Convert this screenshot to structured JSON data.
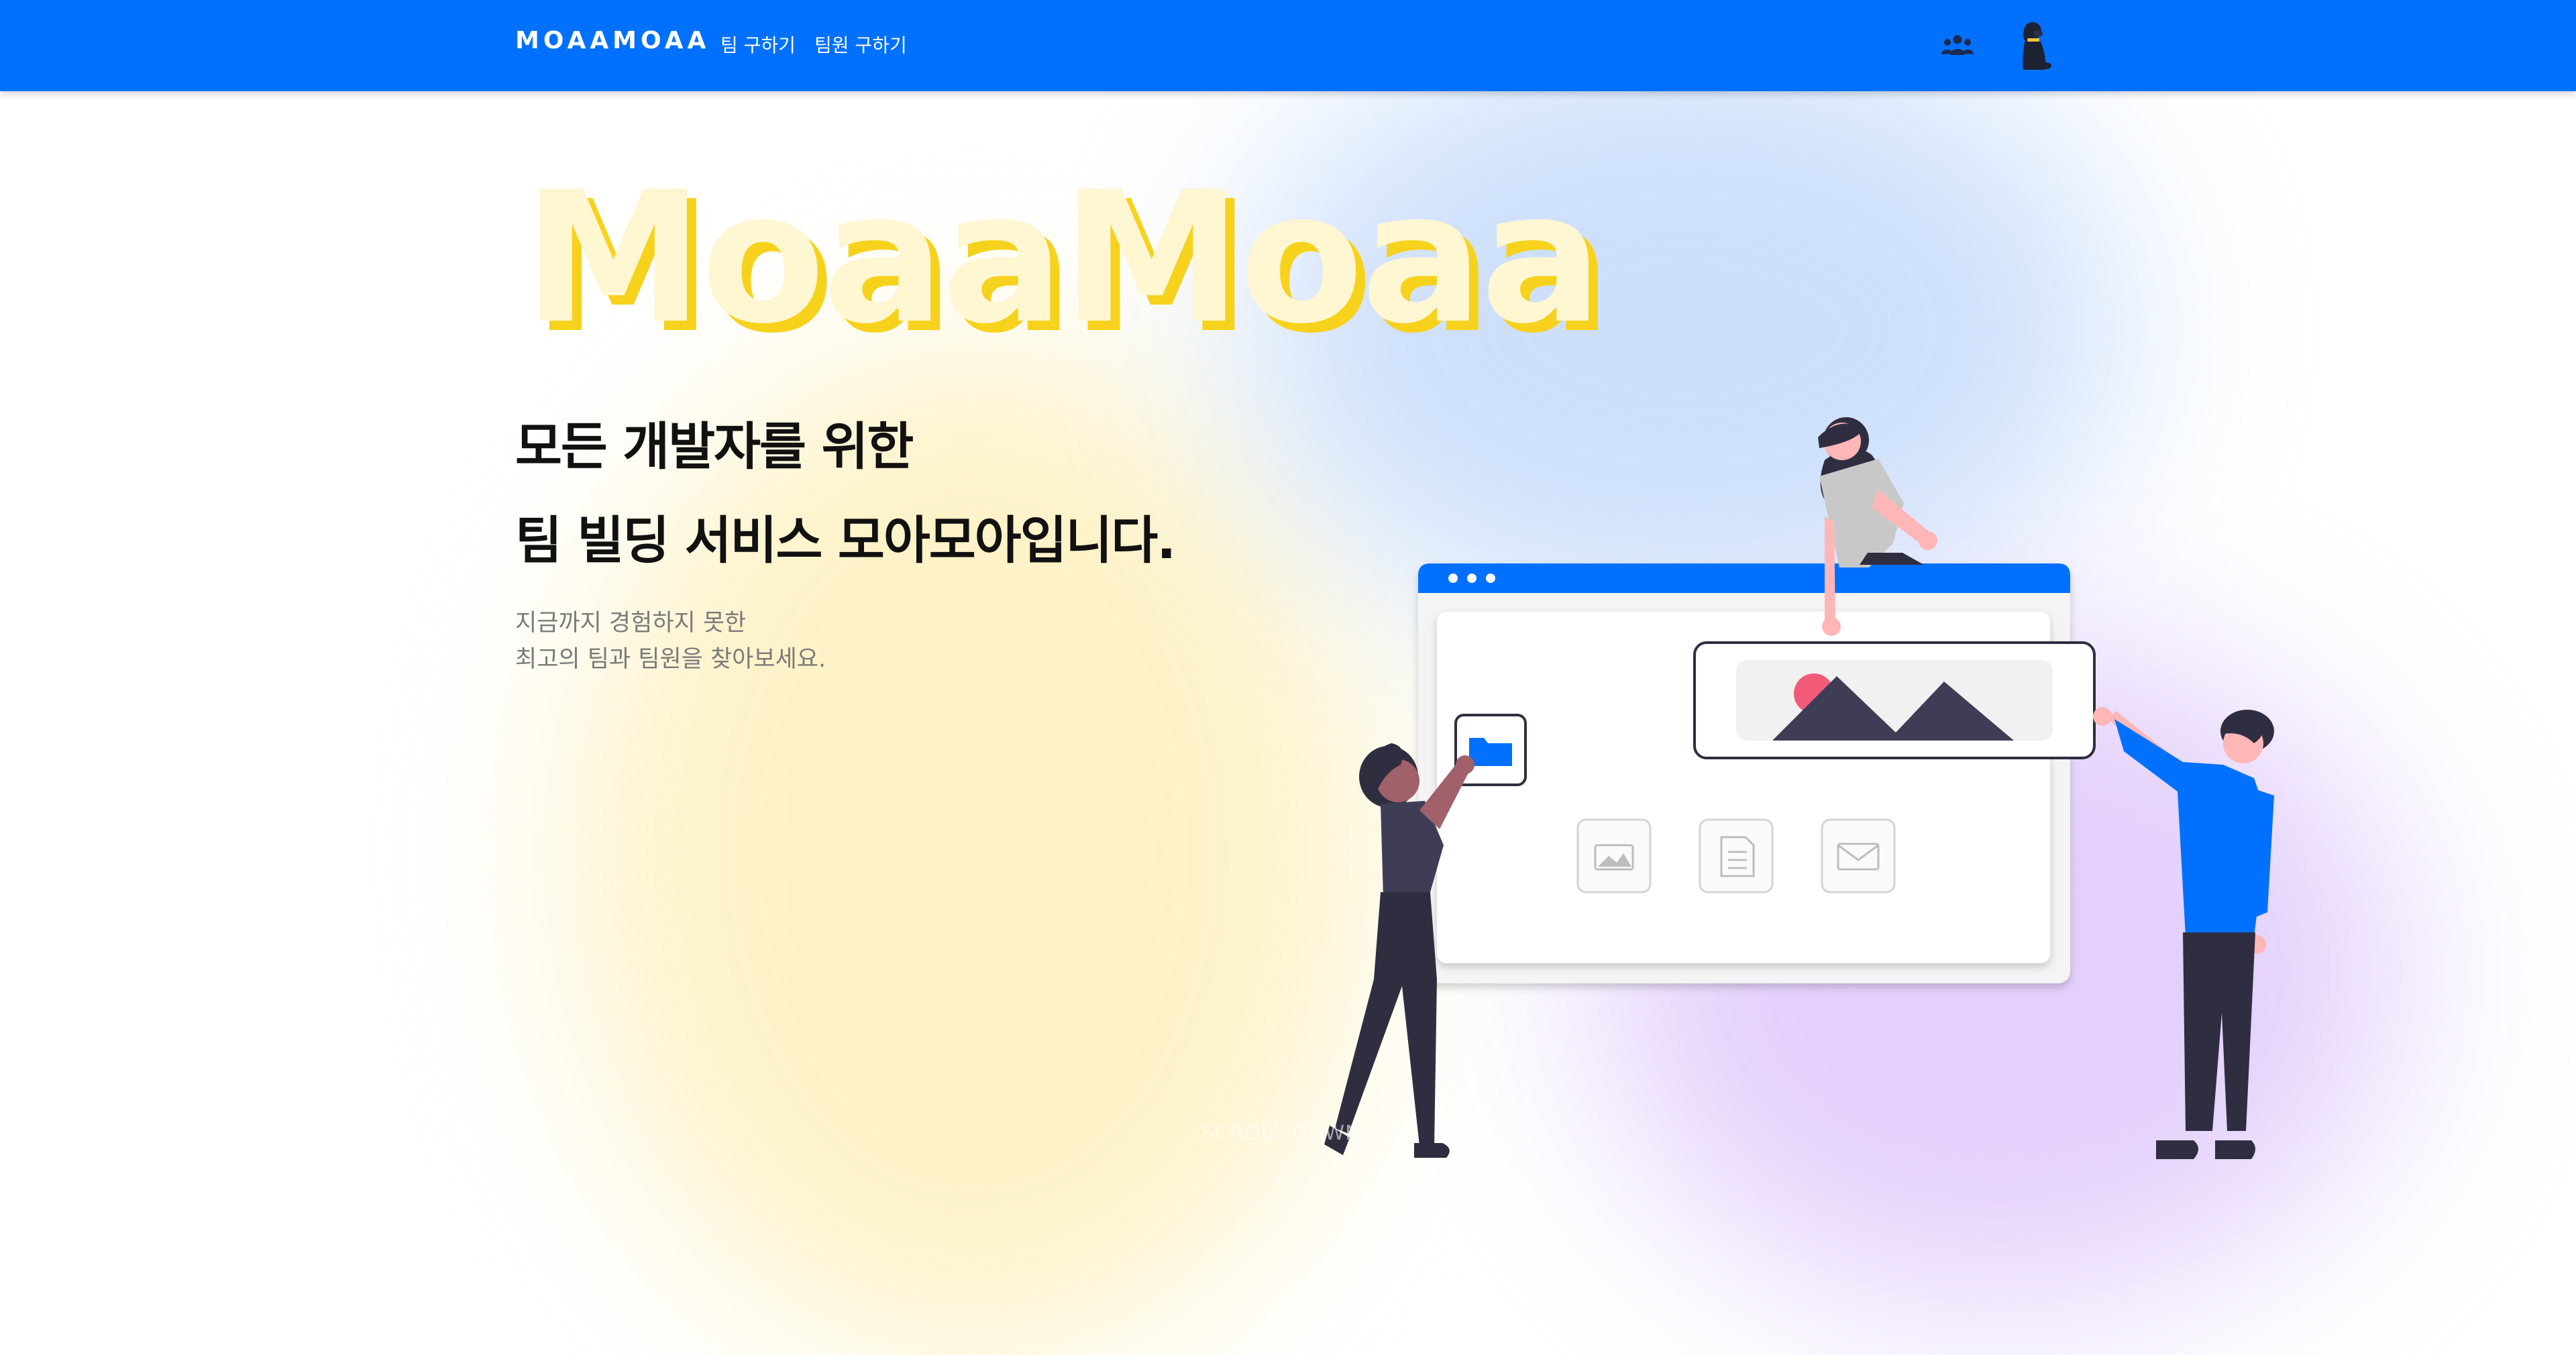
{
  "nav": {
    "brand": "MOAAMOAA",
    "links": [
      "팀 구하기",
      "팀원 구하기"
    ],
    "icons": [
      "group-icon",
      "dog-avatar-icon"
    ]
  },
  "hero": {
    "title": "MoaaMoaa",
    "headline_line1": "모든 개발자를 위한",
    "headline_line2": "팀 빌딩 서비스 모아모아입니다.",
    "sub_line1": "지금까지 경험하지 못한",
    "sub_line2": "최고의 팀과 팀원을 찾아보세요."
  },
  "scroll": {
    "label": "SCROLL DOWN",
    "icon": "chevron-down-icon"
  },
  "colors": {
    "nav_bg": "#0070ff",
    "title_fill": "#fff6d2",
    "title_shadow": "#f7d21c",
    "browser_accent": "#0070ff"
  }
}
